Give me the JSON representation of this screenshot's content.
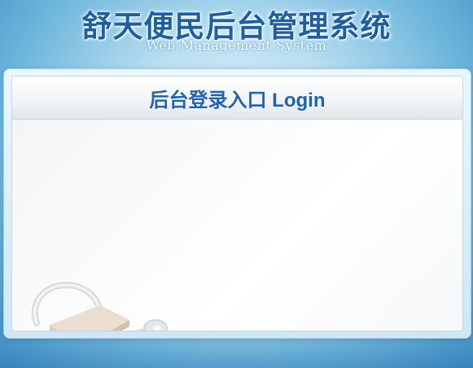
{
  "header": {
    "title": "舒天便民后台管理系统",
    "subtitle": "Web Management System"
  },
  "login_panel": {
    "title": "后台登录入口 Login"
  },
  "colors": {
    "title_blue": "#1d5fa0",
    "panel_title_blue": "#1e63b0",
    "background_blue": "#6fb6dc"
  },
  "decorations": {
    "illustration": "padlock-with-key-icon"
  }
}
